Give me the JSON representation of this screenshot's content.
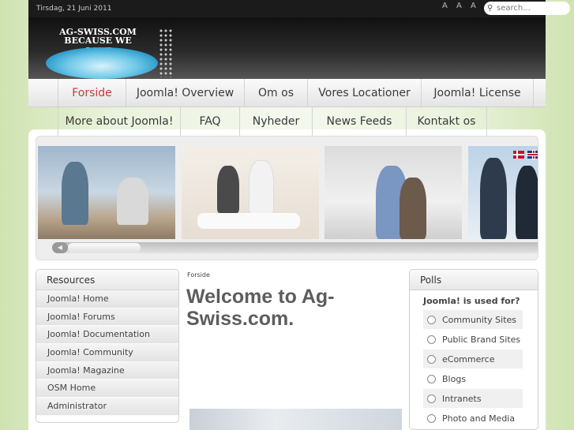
{
  "topbar": {
    "date": "Tirsdag, 21 Juni 2011",
    "font_sizer": "A A A",
    "search_placeholder": "search..."
  },
  "logo": {
    "line1": "AG-SWISS.COM",
    "line2": "BECAUSE WE CARE"
  },
  "nav": {
    "row1": [
      {
        "label": "Forside",
        "active": true
      },
      {
        "label": "Joomla! Overview"
      },
      {
        "label": "Om os"
      },
      {
        "label": "Vores Locationer"
      },
      {
        "label": "Joomla! License"
      }
    ],
    "row2": [
      {
        "label": "More about Joomla!"
      },
      {
        "label": "FAQ"
      },
      {
        "label": "Nyheder"
      },
      {
        "label": "News Feeds"
      },
      {
        "label": "Kontakt os"
      }
    ]
  },
  "slider": {
    "flags": [
      "danish-flag-icon",
      "uk-flag-icon"
    ],
    "scroll_left_icon": "chevron-left-icon"
  },
  "resources": {
    "title": "Resources",
    "items": [
      "Joomla! Home",
      "Joomla! Forums",
      "Joomla! Documentation",
      "Joomla! Community",
      "Joomla! Magazine",
      "OSM Home",
      "Administrator"
    ]
  },
  "content": {
    "breadcrumb": "Forside",
    "title": "Welcome to Ag-Swiss.com."
  },
  "polls": {
    "title": "Polls",
    "question": "Joomla! is used for?",
    "options": [
      "Community Sites",
      "Public Brand Sites",
      "eCommerce",
      "Blogs",
      "Intranets",
      "Photo and Media"
    ]
  },
  "colors": {
    "accent_active": "#c23b3b",
    "header_dark": "#1b1b1b",
    "page_bg": "#eaf3dd"
  }
}
